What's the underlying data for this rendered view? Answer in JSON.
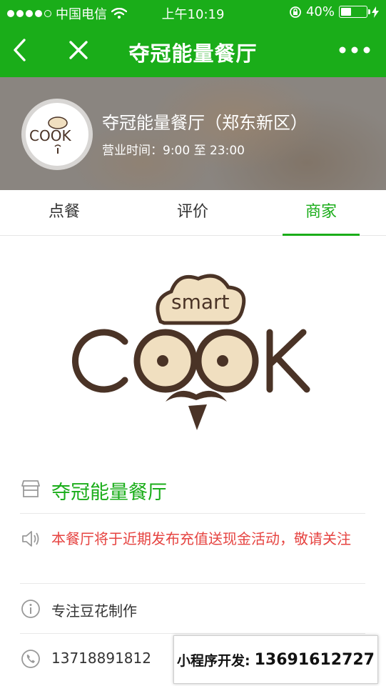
{
  "status_bar": {
    "carrier": "中国电信",
    "time": "上午10:19",
    "battery_percent": "40%",
    "battery_level": 0.4,
    "icons": [
      "signal-dots",
      "wifi-icon",
      "rotation-lock-icon",
      "battery-icon",
      "charging-icon"
    ]
  },
  "nav": {
    "title": "夺冠能量餐厅",
    "icons": [
      "back-arrow-icon",
      "close-icon",
      "more-dots-icon"
    ]
  },
  "header": {
    "store_name": "夺冠能量餐厅（郑东新区）",
    "hours": "营业时间：9:00 至 23:00",
    "avatar_logo_text": "COOK"
  },
  "tabs": [
    {
      "label": "点餐"
    },
    {
      "label": "评价"
    },
    {
      "label": "商家"
    }
  ],
  "active_tab": "商家",
  "logo": {
    "small_text": "smart",
    "big_text": "COOK"
  },
  "info": {
    "name": "夺冠能量餐厅",
    "notice": "本餐厅将于近期发布充值送现金活动，敬请关注",
    "description": "专注豆花制作",
    "phone": "13718891812"
  },
  "dev_badge": {
    "label": "小程序开发:",
    "phone": "13691612727"
  },
  "colors": {
    "brand_green": "#1aad19",
    "notice_red": "#e64340",
    "logo_brown": "#4a3326",
    "logo_beige": "#f0dfc0"
  }
}
